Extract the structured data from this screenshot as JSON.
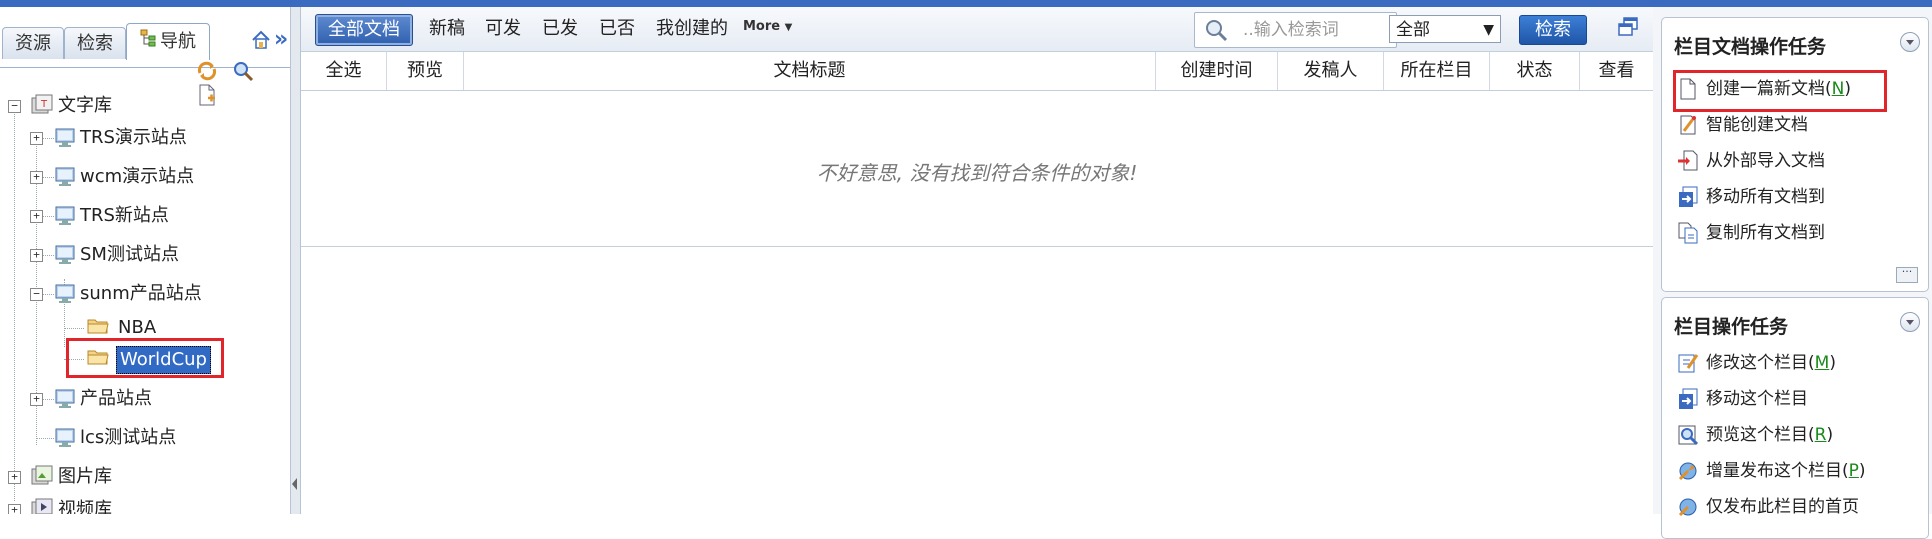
{
  "left_panel": {
    "tabs": [
      "资源",
      "检索",
      "导航"
    ],
    "tree": {
      "root": "文字库",
      "sites": [
        "TRS演示站点",
        "wcm演示站点",
        "TRS新站点",
        "SM测试站点",
        "sunm产品站点"
      ],
      "sunm_children": [
        "NBA",
        "WorldCup"
      ],
      "more_sites": [
        "产品站点",
        "lcs测试站点"
      ],
      "libs": [
        "图片库",
        "视频库"
      ]
    }
  },
  "toolbar": {
    "tabs": [
      "全部文档",
      "新稿",
      "可发",
      "已发",
      "已否",
      "我创建的"
    ],
    "more": "More",
    "search_placeholder": "..输入检索词",
    "scope": "全部",
    "search_button": "检索"
  },
  "table": {
    "columns": [
      "全选",
      "预览",
      "文档标题",
      "创建时间",
      "发稿人",
      "所在栏目",
      "状态",
      "查看"
    ],
    "empty_message": "不好意思, 没有找到符合条件的对象!"
  },
  "right_panel": {
    "doc_tasks_title": "栏目文档操作任务",
    "doc_tasks": [
      {
        "label": "创建一篇新文档",
        "key": "N"
      },
      {
        "label": "智能创建文档",
        "key": ""
      },
      {
        "label": "从外部导入文档",
        "key": ""
      },
      {
        "label": "移动所有文档到",
        "key": ""
      },
      {
        "label": "复制所有文档到",
        "key": ""
      }
    ],
    "channel_tasks_title": "栏目操作任务",
    "channel_tasks": [
      {
        "label": "修改这个栏目",
        "key": "M"
      },
      {
        "label": "移动这个栏目",
        "key": ""
      },
      {
        "label": "预览这个栏目",
        "key": "R"
      },
      {
        "label": "增量发布这个栏目",
        "key": "P"
      },
      {
        "label": "仅发布此栏目的首页",
        "key": ""
      }
    ]
  },
  "colors": {
    "accent": "#3a6bc0",
    "highlight_box": "#e0262b",
    "selection": "#316ac5"
  }
}
